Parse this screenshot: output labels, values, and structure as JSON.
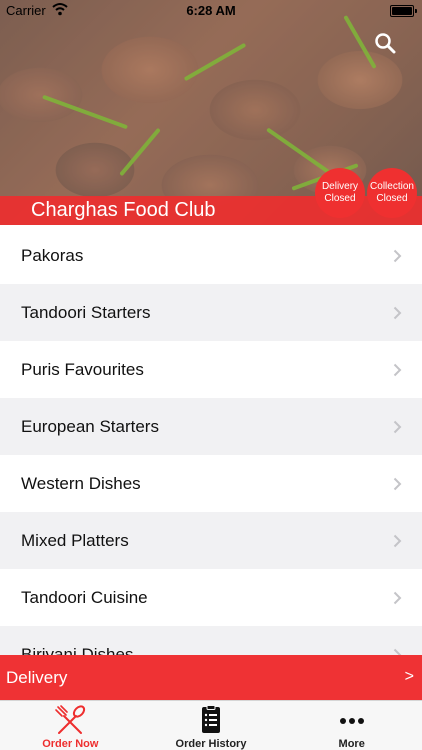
{
  "status_bar": {
    "carrier": "Carrier",
    "time": "6:28 AM"
  },
  "header": {
    "restaurant_name": "Charghas Food Club",
    "search_icon": "search-icon",
    "badges": [
      {
        "line1": "Delivery",
        "line2": "Closed"
      },
      {
        "line1": "Collection",
        "line2": "Closed"
      }
    ]
  },
  "menu": {
    "items": [
      {
        "label": "Pakoras"
      },
      {
        "label": "Tandoori Starters"
      },
      {
        "label": "Puris Favourites"
      },
      {
        "label": "European Starters"
      },
      {
        "label": "Western Dishes"
      },
      {
        "label": "Mixed Platters"
      },
      {
        "label": "Tandoori Cuisine"
      },
      {
        "label": "Biriyani Dishes"
      }
    ]
  },
  "delivery_bar": {
    "label": "Delivery",
    "arrow": ">"
  },
  "tabbar": {
    "tabs": [
      {
        "label": "Order Now",
        "icon": "fork-knife-icon"
      },
      {
        "label": "Order History",
        "icon": "receipt-icon"
      },
      {
        "label": "More",
        "icon": "more-dots-icon"
      }
    ]
  },
  "colors": {
    "accent": "#ef3030",
    "alt_row": "#f1f1f3"
  }
}
